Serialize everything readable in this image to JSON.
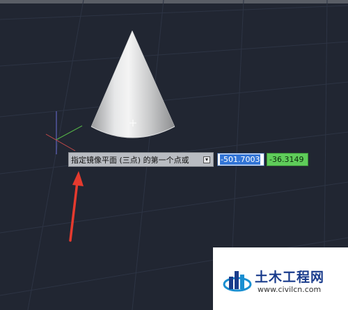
{
  "command_prompt": {
    "text": "指定镜像平面 (三点) 的第一个点或",
    "dropdown_icon": "dropdown-arrow-icon"
  },
  "coordinate_input": {
    "x_value": "-501.7003",
    "y_value": "-36.3149"
  },
  "watermark": {
    "title": "土木工程网",
    "url": "www.civilcn.com"
  },
  "colors": {
    "background": "#212632",
    "x_input_highlight": "#3375d6",
    "y_input": "#5fcd5a",
    "annotation_arrow": "#e53a2e"
  }
}
